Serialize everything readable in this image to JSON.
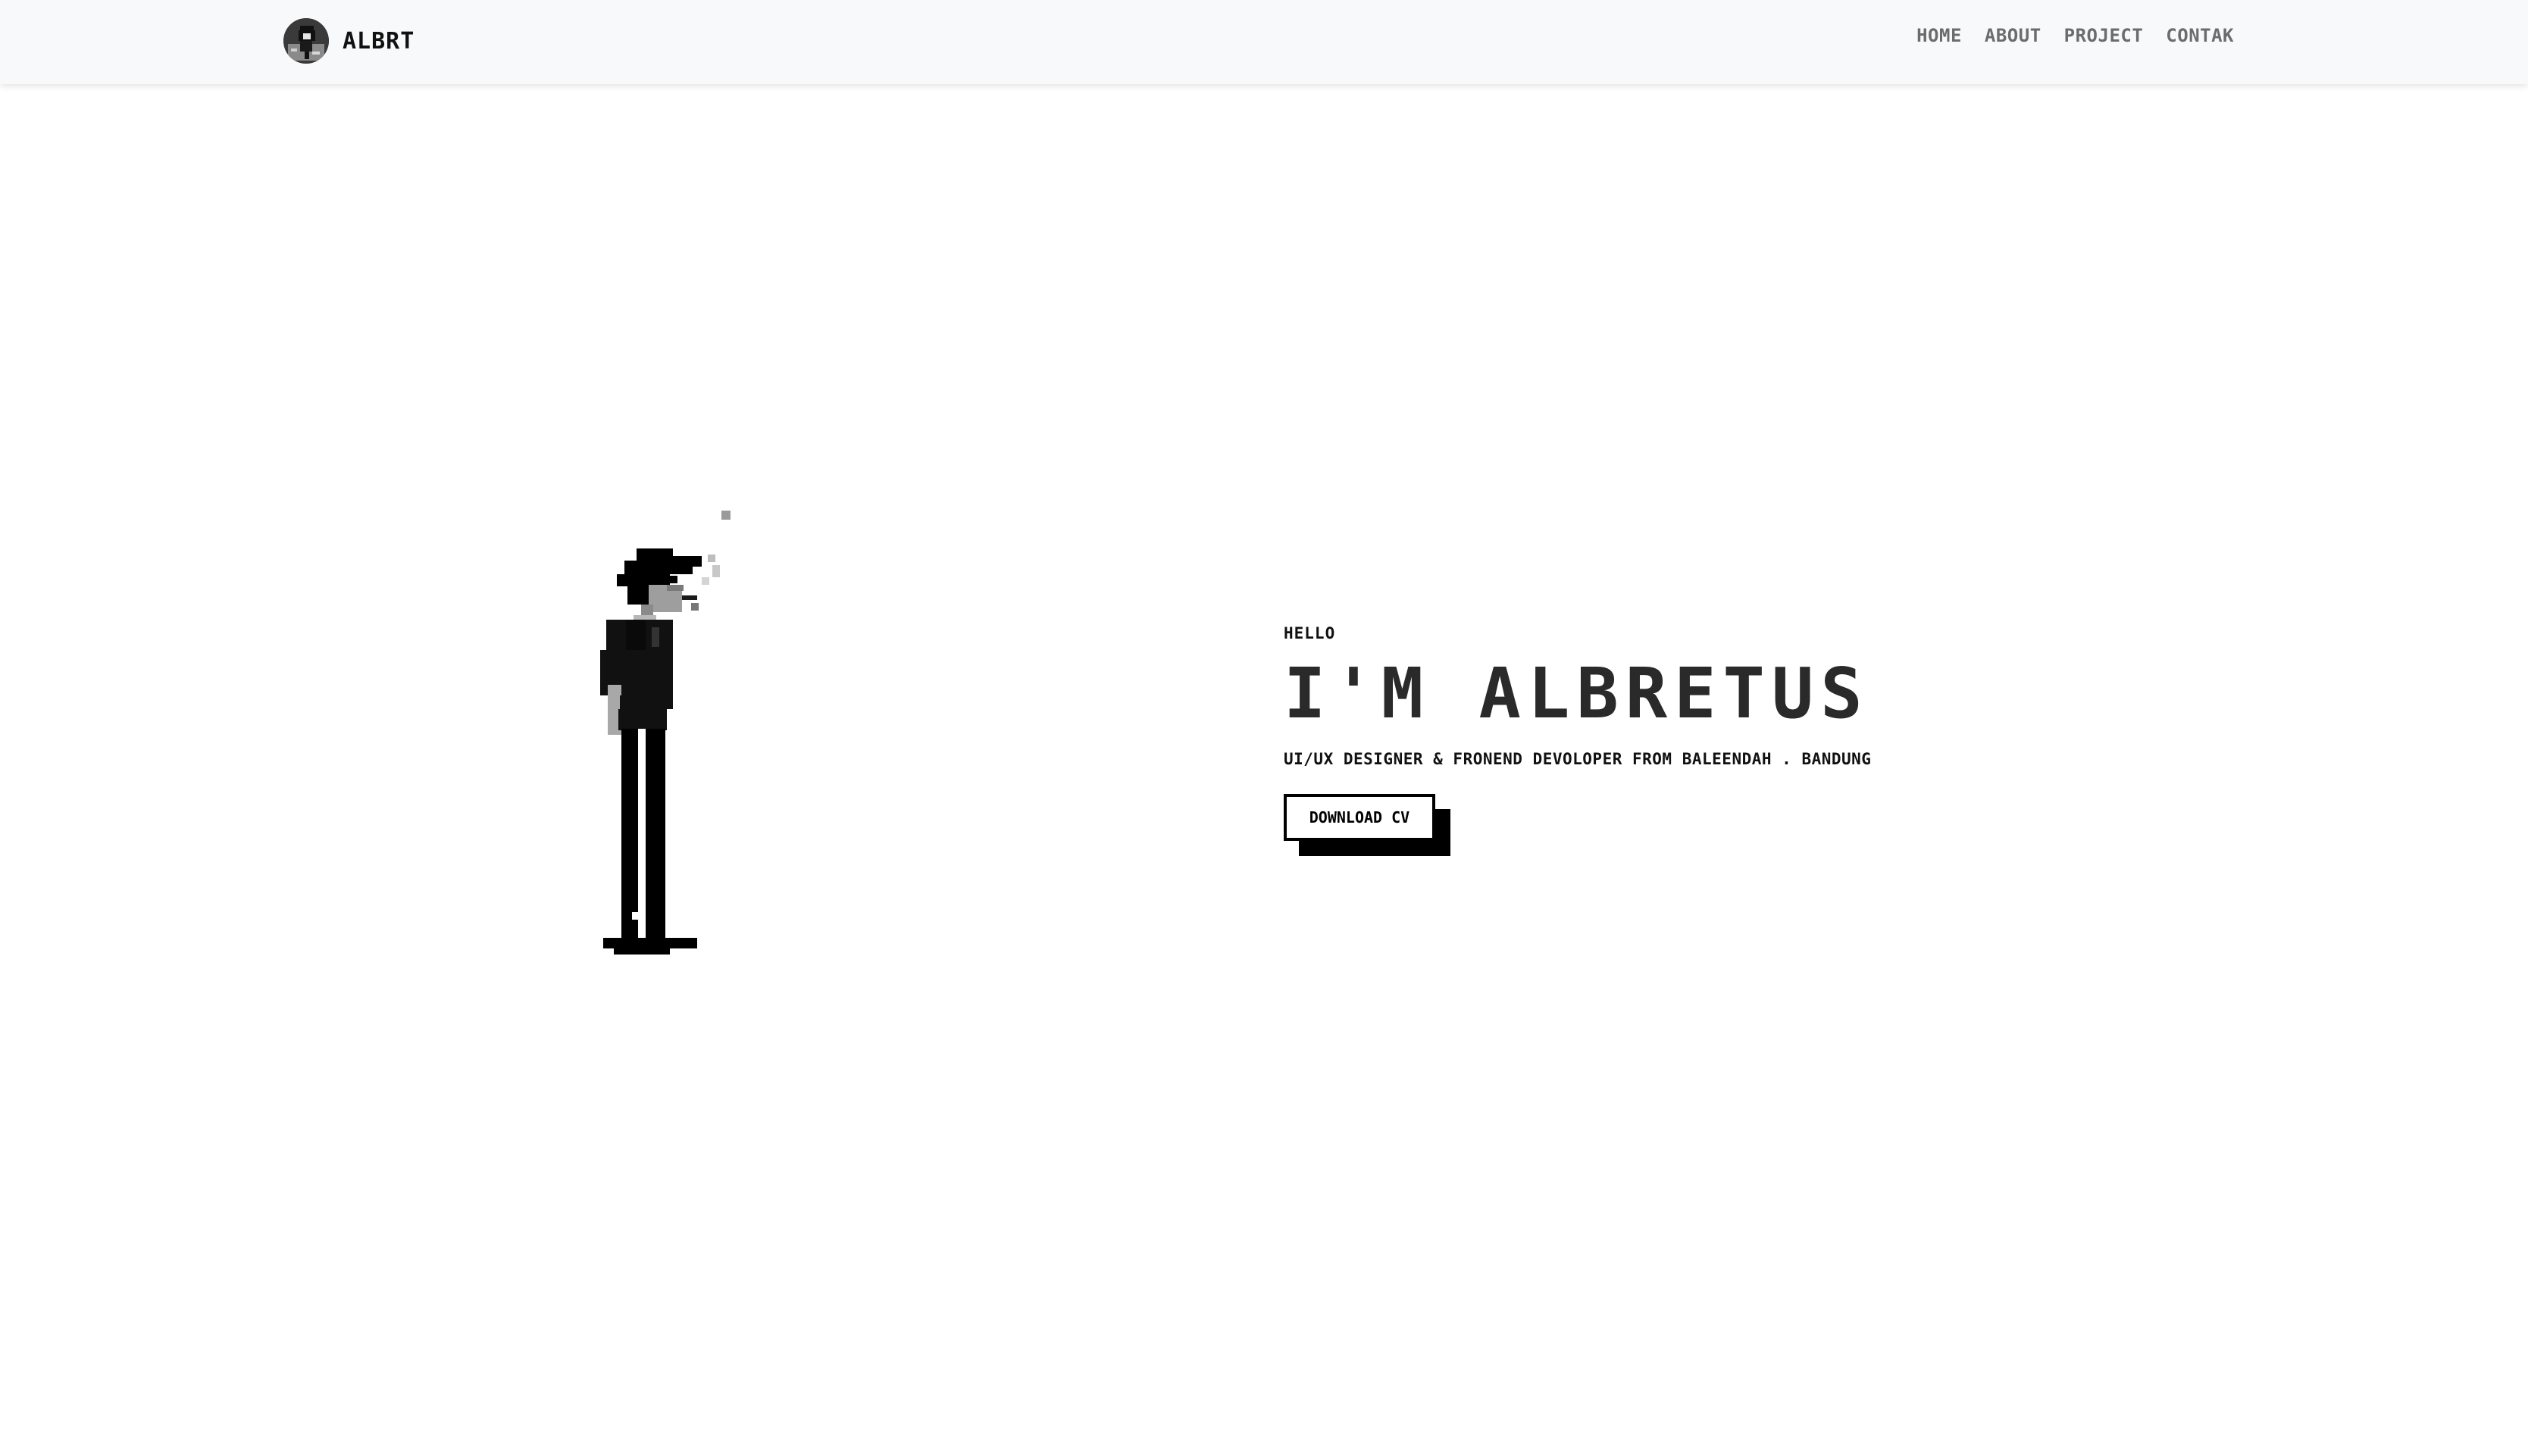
{
  "navbar": {
    "brand_name": "ALBRT",
    "links": [
      {
        "label": "HOME"
      },
      {
        "label": "ABOUT"
      },
      {
        "label": "PROJECT"
      },
      {
        "label": "CONTAK"
      }
    ]
  },
  "hero": {
    "greeting": "HELLO",
    "title": "I'M ALBRETUS",
    "subtitle": "UI/UX DESIGNER & FRONEND DEVOLOPER FROM BALEENDAH . BANDUNG",
    "cv_button_label": "DOWNLOAD CV"
  },
  "colors": {
    "navbar_bg": "#f8f9fa",
    "text_primary": "#111111",
    "nav_link": "#6c6c6c",
    "button_shadow": "#000000"
  },
  "icons": {
    "brand_logo": "pixel-avatar-logo",
    "hero_illustration": "pixel-man-smoking-illustration"
  }
}
